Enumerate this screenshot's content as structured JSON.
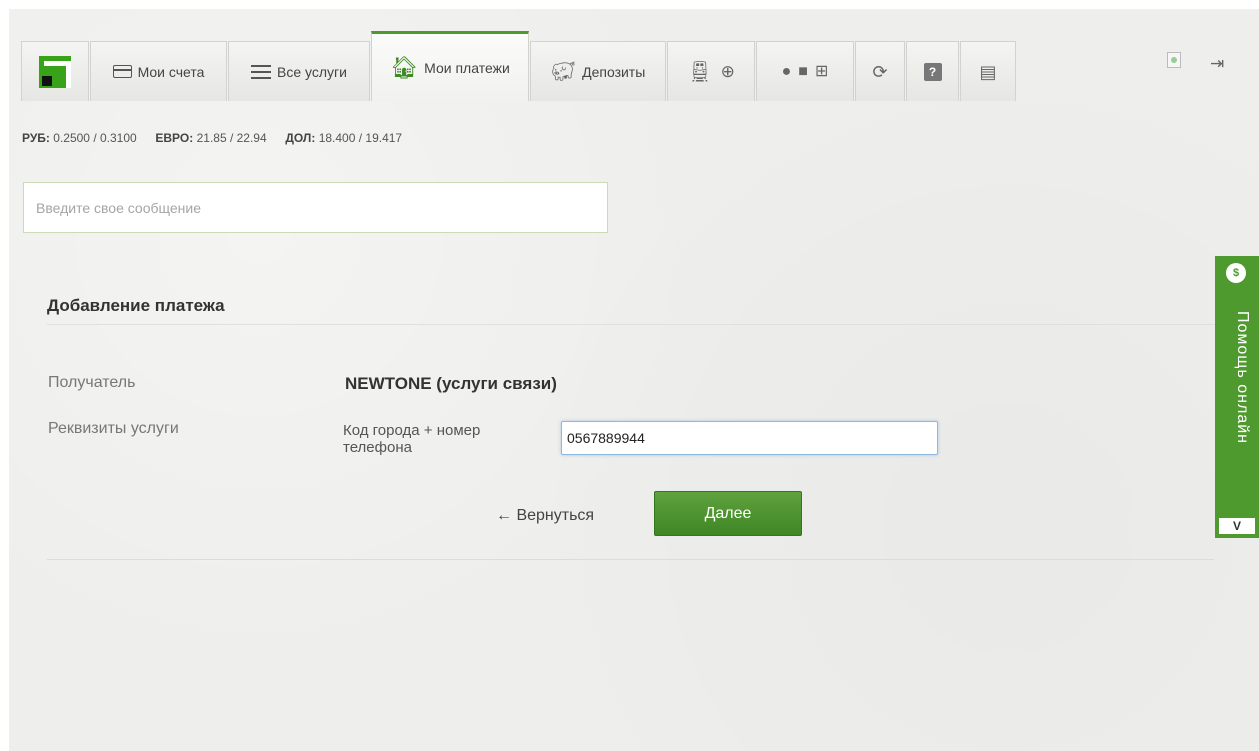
{
  "nav": {
    "tabs": [
      {
        "label": "Мои счета",
        "icon": "card-icon"
      },
      {
        "label": "Все услуги",
        "icon": "list-icon"
      },
      {
        "label": "Мои платежи",
        "icon": "home-icon"
      },
      {
        "label": "Депозиты",
        "icon": "piggy-bank-icon"
      }
    ],
    "active_tab": "Мои платежи",
    "accent_color": "#4e9a2e"
  },
  "rates": {
    "rub_label": "РУБ:",
    "rub_value": "0.2500 / 0.3100",
    "eur_label": "ЕВРО:",
    "eur_value": "21.85 / 22.94",
    "usd_label": "ДОЛ:",
    "usd_value": "18.400 / 19.417"
  },
  "message": {
    "placeholder": "Введите свое сообщение"
  },
  "form": {
    "title": "Добавление платежа",
    "recipient_label": "Получатель",
    "recipient_value": "NEWTONE (услуги связи)",
    "service_label": "Реквизиты услуги",
    "field_label": "Код города + номер телефона",
    "field_value": "0567889944",
    "back_label": "← Вернуться",
    "next_label": "Далее"
  },
  "help": {
    "label": "Помощь онлайн",
    "toggle": "V"
  }
}
